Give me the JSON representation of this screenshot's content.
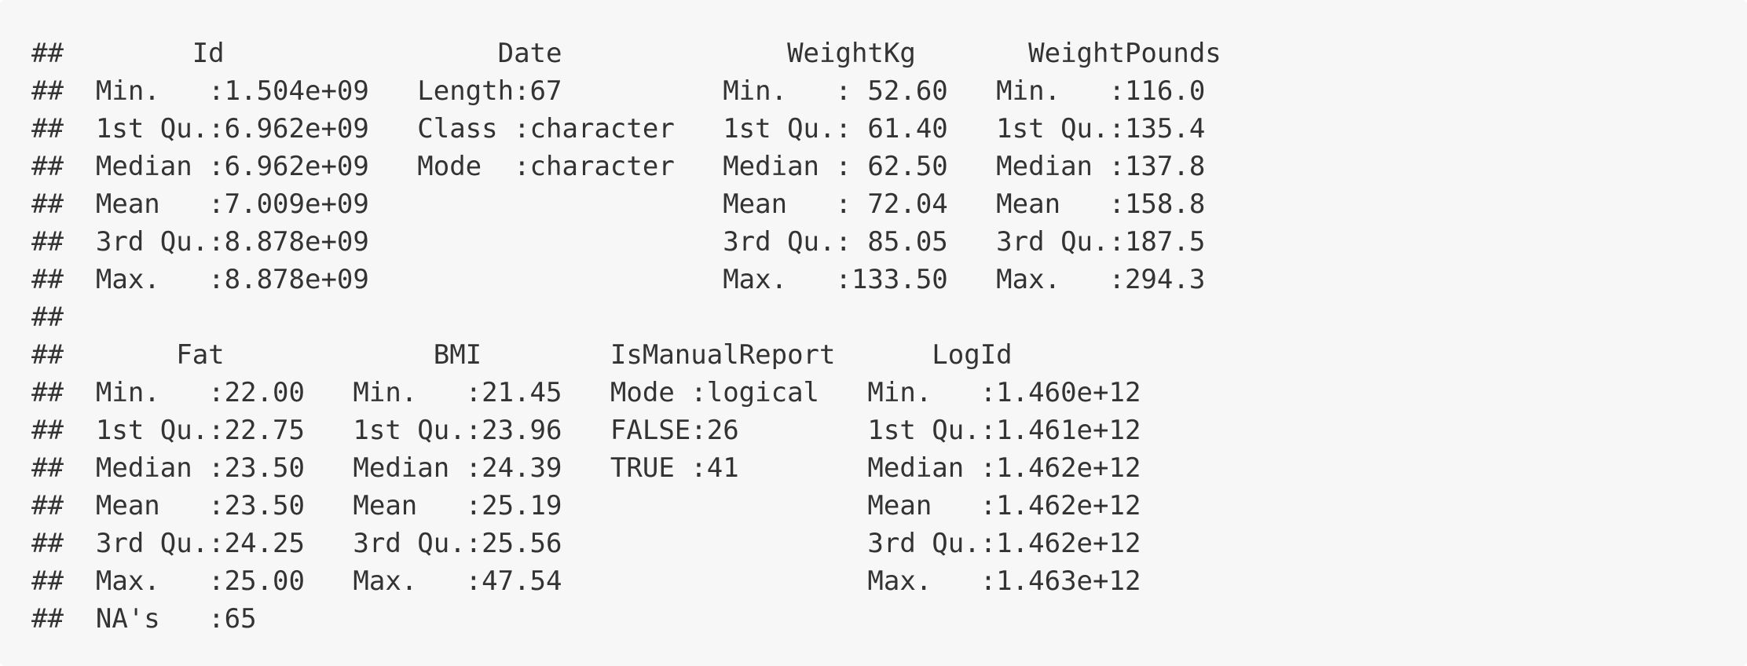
{
  "output": {
    "lines": [
      "##        Id                 Date              WeightKg       WeightPounds",
      "##  Min.   :1.504e+09   Length:67          Min.   : 52.60   Min.   :116.0  ",
      "##  1st Qu.:6.962e+09   Class :character   1st Qu.: 61.40   1st Qu.:135.4  ",
      "##  Median :6.962e+09   Mode  :character   Median : 62.50   Median :137.8  ",
      "##  Mean   :7.009e+09                      Mean   : 72.04   Mean   :158.8  ",
      "##  3rd Qu.:8.878e+09                      3rd Qu.: 85.05   3rd Qu.:187.5  ",
      "##  Max.   :8.878e+09                      Max.   :133.50   Max.   :294.3  ",
      "##                                                                         ",
      "##       Fat             BMI        IsManualReport      LogId            ",
      "##  Min.   :22.00   Min.   :21.45   Mode :logical   Min.   :1.460e+12  ",
      "##  1st Qu.:22.75   1st Qu.:23.96   FALSE:26        1st Qu.:1.461e+12  ",
      "##  Median :23.50   Median :24.39   TRUE :41        Median :1.462e+12  ",
      "##  Mean   :23.50   Mean   :25.19                   Mean   :1.462e+12  ",
      "##  3rd Qu.:24.25   3rd Qu.:25.56                   3rd Qu.:1.462e+12  ",
      "##  Max.   :25.00   Max.   :47.54                   Max.   :1.463e+12  ",
      "##  NA's   :65                                                         "
    ]
  }
}
